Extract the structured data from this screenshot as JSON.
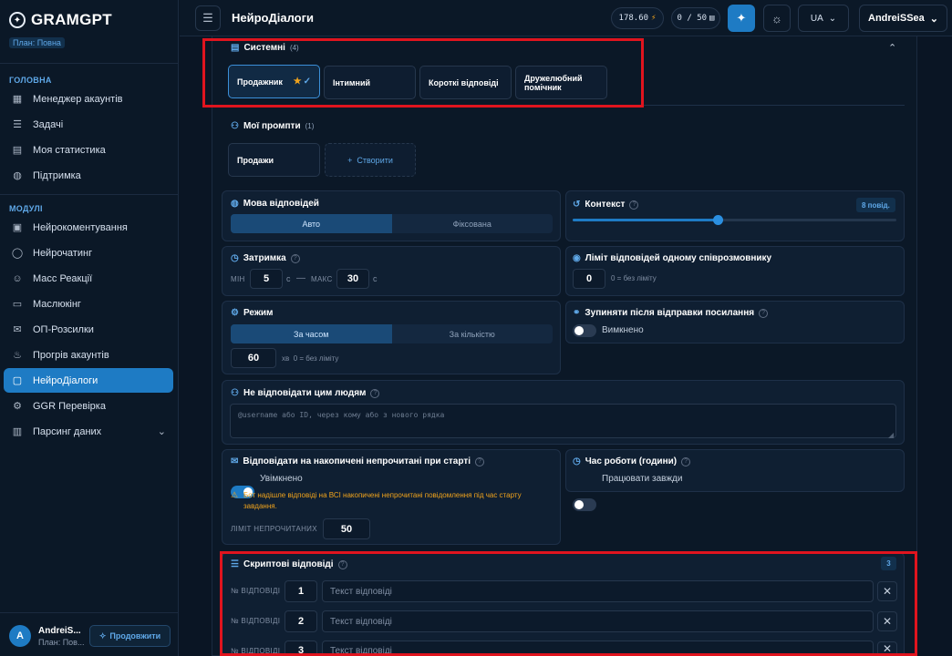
{
  "app": {
    "name": "GRAMGPT",
    "plan": "План: Повна"
  },
  "sidebar": {
    "section_main": "ГОЛОВНА",
    "main_items": [
      {
        "label": "Менеджер акаунтів",
        "icon": "grid-icon"
      },
      {
        "label": "Задачі",
        "icon": "list-icon"
      },
      {
        "label": "Моя статистика",
        "icon": "stats-icon"
      },
      {
        "label": "Підтримка",
        "icon": "globe-icon"
      }
    ],
    "section_modules": "МОДУЛІ",
    "module_items": [
      {
        "label": "Нейрокоментування",
        "icon": "comment-icon"
      },
      {
        "label": "Нейрочатинг",
        "icon": "chat-icon"
      },
      {
        "label": "Масс Реакції",
        "icon": "smile-icon"
      },
      {
        "label": "Маслюкінг",
        "icon": "monitor-icon"
      },
      {
        "label": "ОП-Розсилки",
        "icon": "mail-icon"
      },
      {
        "label": "Прогрів акаунтів",
        "icon": "flame-icon"
      },
      {
        "label": "НейроДіалоги",
        "icon": "dialog-icon",
        "active": true
      },
      {
        "label": "GGR Перевірка",
        "icon": "gear-icon"
      },
      {
        "label": "Парсинг даних",
        "icon": "database-icon"
      }
    ],
    "user": {
      "initial": "A",
      "name": "AndreiS...",
      "plan": "План: Пов...",
      "extend_label": "Продовжити"
    }
  },
  "topbar": {
    "title": "НейроДіалоги",
    "balance": "178.60",
    "balance_icon": "⚡",
    "counter": "0 / 50",
    "lang": "UA",
    "account": "AndreiSSea"
  },
  "system_prompts": {
    "title": "Системні",
    "count": "(4)",
    "items": [
      "Продажник",
      "Інтимний",
      "Короткі відповіді",
      "Дружелюбний помічник"
    ]
  },
  "my_prompts": {
    "title": "Мої промпти",
    "count": "(1)",
    "items": [
      "Продажи"
    ],
    "create_label": "Створити"
  },
  "language": {
    "title": "Мова відповідей",
    "options": [
      "Авто",
      "Фіксована"
    ],
    "selected": "Авто"
  },
  "context": {
    "title": "Контекст",
    "badge": "8 повід.",
    "value": 8
  },
  "delay": {
    "title": "Затримка",
    "min_label": "МІН",
    "min": "5",
    "unit": "с",
    "dash": "—",
    "max_label": "МАКС",
    "max": "30"
  },
  "reply_limit": {
    "title": "Ліміт відповідей одному співрозмовнику",
    "value": "0",
    "hint": "0 = без ліміту"
  },
  "mode": {
    "title": "Режим",
    "options": [
      "За часом",
      "За кількістю"
    ],
    "selected": "За часом",
    "value": "60",
    "hint": "хв  0 = без ліміту"
  },
  "stop_after_link": {
    "title": "Зупиняти після відправки посилання",
    "state": "Вимкнено"
  },
  "ignore_list": {
    "title": "Не відповідати цим людям",
    "placeholder": "@username або ID, через кому або з нового рядка"
  },
  "reply_unread": {
    "title": "Відповідати на накопичені непрочитані при старті",
    "state": "Увімкнено",
    "warning": "Бот надішле відповіді на ВСІ накопичені непрочитані повідомлення під час старту завдання.",
    "limit_label": "ЛІМІТ НЕПРОЧИТАНИХ",
    "limit": "50"
  },
  "work_time": {
    "title": "Час роботи (години)",
    "state": "Працювати завжди"
  },
  "scripted": {
    "title": "Скриптові відповіді",
    "count": "3",
    "num_label": "№ ВІДПОВІДІ",
    "placeholder": "Текст відповіді",
    "rows": [
      "1",
      "2",
      "3"
    ]
  },
  "colors": {
    "accent": "#1e7bc4",
    "highlight": "#e0141e",
    "warning": "#f0a31c"
  }
}
